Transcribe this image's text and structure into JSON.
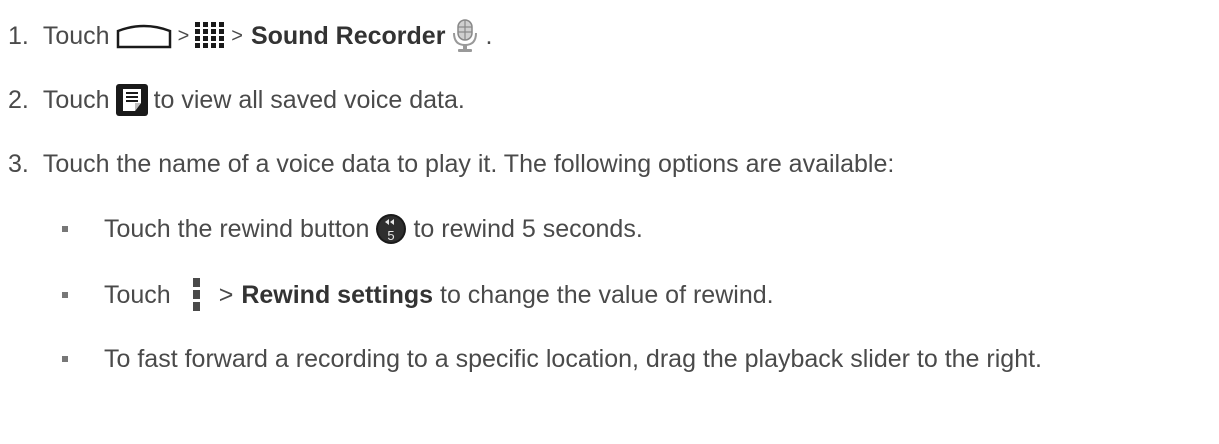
{
  "steps": [
    {
      "number": "1.",
      "prefix": "Touch",
      "sep1": ">",
      "sep2": ">",
      "bold": "Sound Recorder",
      "suffix": ".",
      "icons": [
        "home-icon",
        "apps-icon",
        "sound-recorder-icon"
      ]
    },
    {
      "number": "2.",
      "prefix": "Touch",
      "suffix": "to view all saved voice data.",
      "icons": [
        "list-icon"
      ]
    },
    {
      "number": "3.",
      "text": "Touch the name of a voice data to play it. The following options are available:"
    }
  ],
  "options": [
    {
      "prefix": "Touch the rewind button",
      "suffix": "to rewind 5 seconds.",
      "icon_label": "5",
      "icons": [
        "rewind-5-icon"
      ]
    },
    {
      "prefix": "Touch",
      "sep": ">",
      "bold": "Rewind settings",
      "suffix": "to change the value of rewind.",
      "icons": [
        "menu-icon"
      ]
    },
    {
      "text": "To fast forward a recording to a specific location, drag the playback slider to the right."
    }
  ],
  "colors": {
    "text": "#4a4a4a",
    "icon_dark": "#1a1a1a",
    "bullet": "#777777"
  }
}
